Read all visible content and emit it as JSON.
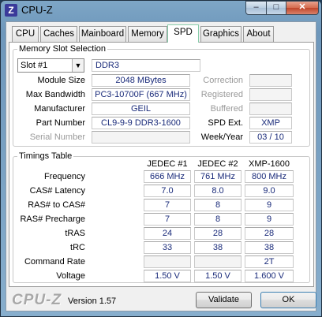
{
  "window": {
    "title": "CPU-Z",
    "app_icon_letter": "Z",
    "min_glyph": "–",
    "max_glyph": "□",
    "close_glyph": "✕"
  },
  "tabs": [
    {
      "label": "CPU",
      "active": false
    },
    {
      "label": "Caches",
      "active": false
    },
    {
      "label": "Mainboard",
      "active": false
    },
    {
      "label": "Memory",
      "active": false
    },
    {
      "label": "SPD",
      "active": true
    },
    {
      "label": "Graphics",
      "active": false
    },
    {
      "label": "About",
      "active": false
    }
  ],
  "slot_selection": {
    "group_label": "Memory Slot Selection",
    "selected": "Slot #1",
    "memory_type": "DDR3",
    "module_size_label": "Module Size",
    "module_size": "2048 MBytes",
    "max_bandwidth_label": "Max Bandwidth",
    "max_bandwidth": "PC3-10700F (667 MHz)",
    "manufacturer_label": "Manufacturer",
    "manufacturer": "GEIL",
    "part_number_label": "Part Number",
    "part_number": "CL9-9-9 DDR3-1600",
    "serial_number_label": "Serial Number",
    "serial_number": "",
    "correction_label": "Correction",
    "correction": "",
    "registered_label": "Registered",
    "registered": "",
    "buffered_label": "Buffered",
    "buffered": "",
    "spd_ext_label": "SPD Ext.",
    "spd_ext": "XMP",
    "week_year_label": "Week/Year",
    "week_year": "03 / 10"
  },
  "timings": {
    "group_label": "Timings Table",
    "columns": [
      "JEDEC #1",
      "JEDEC #2",
      "XMP-1600"
    ],
    "rows": [
      {
        "label": "Frequency",
        "values": [
          "666 MHz",
          "761 MHz",
          "800 MHz"
        ]
      },
      {
        "label": "CAS# Latency",
        "values": [
          "7.0",
          "8.0",
          "9.0"
        ]
      },
      {
        "label": "RAS# to CAS#",
        "values": [
          "7",
          "8",
          "9"
        ]
      },
      {
        "label": "RAS# Precharge",
        "values": [
          "7",
          "8",
          "9"
        ]
      },
      {
        "label": "tRAS",
        "values": [
          "24",
          "28",
          "28"
        ]
      },
      {
        "label": "tRC",
        "values": [
          "33",
          "38",
          "38"
        ]
      },
      {
        "label": "Command Rate",
        "values": [
          "",
          "",
          "2T"
        ]
      },
      {
        "label": "Voltage",
        "values": [
          "1.50 V",
          "1.50 V",
          "1.600 V"
        ]
      }
    ]
  },
  "footer": {
    "logo": "CPU-Z",
    "version": "Version 1.57",
    "validate_label": "Validate",
    "ok_label": "OK"
  }
}
